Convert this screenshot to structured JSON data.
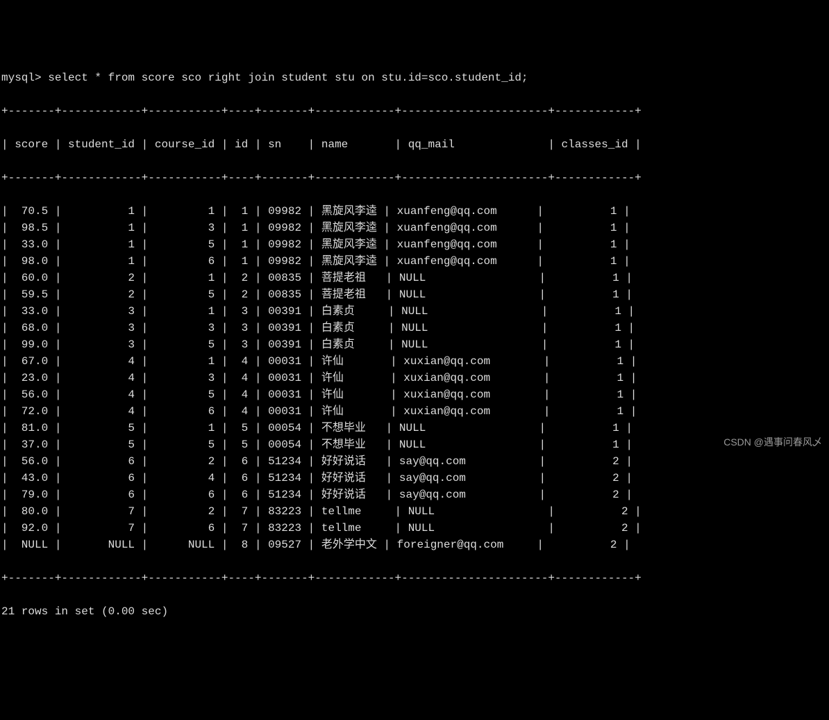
{
  "prompt": "mysql> select * from score sco right join student stu on stu.id=sco.student_id;",
  "columns": [
    "score",
    "student_id",
    "course_id",
    "id",
    "sn",
    "name",
    "qq_mail",
    "classes_id"
  ],
  "rows": [
    {
      "score": "70.5",
      "student_id": "1",
      "course_id": "1",
      "id": "1",
      "sn": "09982",
      "name": "黑旋风李逵",
      "qq_mail": "xuanfeng@qq.com",
      "classes_id": "1"
    },
    {
      "score": "98.5",
      "student_id": "1",
      "course_id": "3",
      "id": "1",
      "sn": "09982",
      "name": "黑旋风李逵",
      "qq_mail": "xuanfeng@qq.com",
      "classes_id": "1"
    },
    {
      "score": "33.0",
      "student_id": "1",
      "course_id": "5",
      "id": "1",
      "sn": "09982",
      "name": "黑旋风李逵",
      "qq_mail": "xuanfeng@qq.com",
      "classes_id": "1"
    },
    {
      "score": "98.0",
      "student_id": "1",
      "course_id": "6",
      "id": "1",
      "sn": "09982",
      "name": "黑旋风李逵",
      "qq_mail": "xuanfeng@qq.com",
      "classes_id": "1"
    },
    {
      "score": "60.0",
      "student_id": "2",
      "course_id": "1",
      "id": "2",
      "sn": "00835",
      "name": "菩提老祖",
      "qq_mail": "NULL",
      "classes_id": "1"
    },
    {
      "score": "59.5",
      "student_id": "2",
      "course_id": "5",
      "id": "2",
      "sn": "00835",
      "name": "菩提老祖",
      "qq_mail": "NULL",
      "classes_id": "1"
    },
    {
      "score": "33.0",
      "student_id": "3",
      "course_id": "1",
      "id": "3",
      "sn": "00391",
      "name": "白素贞",
      "qq_mail": "NULL",
      "classes_id": "1"
    },
    {
      "score": "68.0",
      "student_id": "3",
      "course_id": "3",
      "id": "3",
      "sn": "00391",
      "name": "白素贞",
      "qq_mail": "NULL",
      "classes_id": "1"
    },
    {
      "score": "99.0",
      "student_id": "3",
      "course_id": "5",
      "id": "3",
      "sn": "00391",
      "name": "白素贞",
      "qq_mail": "NULL",
      "classes_id": "1"
    },
    {
      "score": "67.0",
      "student_id": "4",
      "course_id": "1",
      "id": "4",
      "sn": "00031",
      "name": "许仙",
      "qq_mail": "xuxian@qq.com",
      "classes_id": "1"
    },
    {
      "score": "23.0",
      "student_id": "4",
      "course_id": "3",
      "id": "4",
      "sn": "00031",
      "name": "许仙",
      "qq_mail": "xuxian@qq.com",
      "classes_id": "1"
    },
    {
      "score": "56.0",
      "student_id": "4",
      "course_id": "5",
      "id": "4",
      "sn": "00031",
      "name": "许仙",
      "qq_mail": "xuxian@qq.com",
      "classes_id": "1"
    },
    {
      "score": "72.0",
      "student_id": "4",
      "course_id": "6",
      "id": "4",
      "sn": "00031",
      "name": "许仙",
      "qq_mail": "xuxian@qq.com",
      "classes_id": "1"
    },
    {
      "score": "81.0",
      "student_id": "5",
      "course_id": "1",
      "id": "5",
      "sn": "00054",
      "name": "不想毕业",
      "qq_mail": "NULL",
      "classes_id": "1"
    },
    {
      "score": "37.0",
      "student_id": "5",
      "course_id": "5",
      "id": "5",
      "sn": "00054",
      "name": "不想毕业",
      "qq_mail": "NULL",
      "classes_id": "1"
    },
    {
      "score": "56.0",
      "student_id": "6",
      "course_id": "2",
      "id": "6",
      "sn": "51234",
      "name": "好好说话",
      "qq_mail": "say@qq.com",
      "classes_id": "2"
    },
    {
      "score": "43.0",
      "student_id": "6",
      "course_id": "4",
      "id": "6",
      "sn": "51234",
      "name": "好好说话",
      "qq_mail": "say@qq.com",
      "classes_id": "2"
    },
    {
      "score": "79.0",
      "student_id": "6",
      "course_id": "6",
      "id": "6",
      "sn": "51234",
      "name": "好好说话",
      "qq_mail": "say@qq.com",
      "classes_id": "2"
    },
    {
      "score": "80.0",
      "student_id": "7",
      "course_id": "2",
      "id": "7",
      "sn": "83223",
      "name": "tellme",
      "qq_mail": "NULL",
      "classes_id": "2"
    },
    {
      "score": "92.0",
      "student_id": "7",
      "course_id": "6",
      "id": "7",
      "sn": "83223",
      "name": "tellme",
      "qq_mail": "NULL",
      "classes_id": "2"
    },
    {
      "score": "NULL",
      "student_id": "NULL",
      "course_id": "NULL",
      "id": "8",
      "sn": "09527",
      "name": "老外学中文",
      "qq_mail": "foreigner@qq.com",
      "classes_id": "2"
    }
  ],
  "footer": "21 rows in set (0.00 sec)",
  "watermark": "CSDN @遇事问春风乄",
  "widths": {
    "score": 7,
    "student_id": 12,
    "course_id": 11,
    "id": 4,
    "sn": 7,
    "name": 12,
    "qq_mail": 22,
    "classes_id": 12
  }
}
